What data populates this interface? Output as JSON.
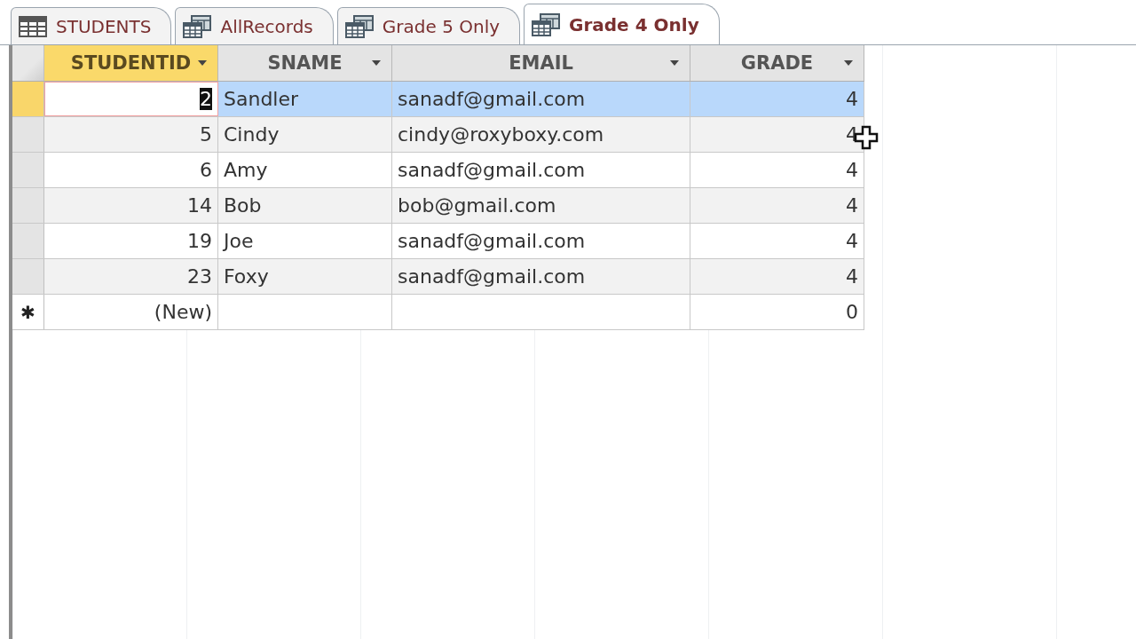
{
  "tabs": [
    {
      "label": "STUDENTS",
      "kind": "table",
      "selected": false
    },
    {
      "label": "AllRecords",
      "kind": "query",
      "selected": false
    },
    {
      "label": "Grade 5 Only",
      "kind": "query",
      "selected": false
    },
    {
      "label": "Grade 4 Only",
      "kind": "query",
      "selected": true
    }
  ],
  "table": {
    "columns": [
      {
        "label": "STUDENTID",
        "kind": "number",
        "selected": true
      },
      {
        "label": "SNAME",
        "kind": "text",
        "selected": false
      },
      {
        "label": "EMAIL",
        "kind": "text",
        "selected": false
      },
      {
        "label": "GRADE",
        "kind": "number",
        "selected": false
      }
    ],
    "rows": [
      {
        "cells": [
          "2",
          "Sandler",
          "sanadf@gmail.com",
          "4"
        ],
        "selected": true
      },
      {
        "cells": [
          "5",
          "Cindy",
          "cindy@roxyboxy.com",
          "4"
        ],
        "selected": false
      },
      {
        "cells": [
          "6",
          "Amy",
          "sanadf@gmail.com",
          "4"
        ],
        "selected": false
      },
      {
        "cells": [
          "14",
          "Bob",
          "bob@gmail.com",
          "4"
        ],
        "selected": false
      },
      {
        "cells": [
          "19",
          "Joe",
          "sanadf@gmail.com",
          "4"
        ],
        "selected": false
      },
      {
        "cells": [
          "23",
          "Foxy",
          "sanadf@gmail.com",
          "4"
        ],
        "selected": false
      }
    ],
    "new_row": {
      "marker": "✱",
      "cells": [
        "(New)",
        "",
        "",
        "0"
      ]
    }
  }
}
